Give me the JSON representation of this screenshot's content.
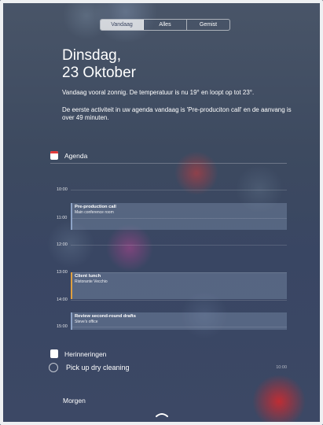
{
  "tabs": [
    {
      "label": "Vandaag",
      "active": true
    },
    {
      "label": "Alles",
      "active": false
    },
    {
      "label": "Gemist",
      "active": false
    }
  ],
  "date": {
    "line1": "Dinsdag,",
    "line2": "23 Oktober"
  },
  "summary": {
    "weather": "Vandaag vooral zonnig. De temperatuur is nu 19° en loopt op tot 23°.",
    "agenda": "De eerste activiteit in uw agenda vandaag is 'Pre-produciton call' en de aanvang is over 49 minuten."
  },
  "agenda": {
    "title": "Agenda",
    "icon": "calendar-icon",
    "hours": [
      "10:00",
      "11:00",
      "12:00",
      "13:00",
      "14:00",
      "15:00"
    ],
    "events": [
      {
        "title": "Pre-production call",
        "location": "Main conference room"
      },
      {
        "title": "Client lunch",
        "location": "Ristorante Vecchio"
      },
      {
        "title": "Review second-round drafts",
        "location": "Steve's office"
      }
    ]
  },
  "reminders": {
    "title": "Herinneringen",
    "icon": "reminders-icon",
    "item": {
      "label": "Pick up dry cleaning",
      "time": "10:00"
    }
  },
  "tomorrow": {
    "title": "Morgen"
  },
  "colors": {
    "calendar_red": "#e23b3b",
    "event_accent": "#8da3c6",
    "event_accent_orange": "#e0a040"
  }
}
